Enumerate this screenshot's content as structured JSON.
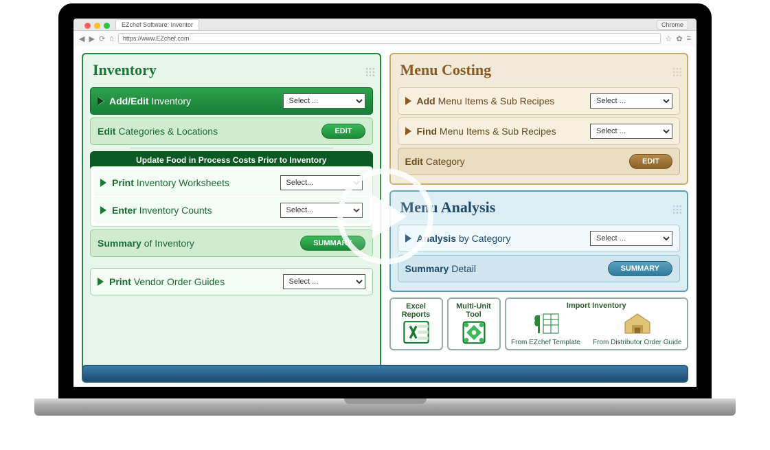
{
  "browser": {
    "tab_title": "EZchef Software: Inventor",
    "browser_name": "Chrome",
    "url": "https://www.EZchef.com"
  },
  "inventory": {
    "title": "Inventory",
    "add_edit_label": "<b>Add/Edit</b> Inventory",
    "add_edit_select": "Select ...",
    "edit_cat_label": "<b>Edit</b> Categories & Locations",
    "edit_btn": "EDIT",
    "banner": "Update Food in Process Costs Prior to Inventory",
    "print_ws_label": "<b>Print</b> Inventory Worksheets",
    "print_ws_select": "Select...",
    "enter_counts_label": "<b>Enter</b> Inventory Counts",
    "enter_counts_select": "Select...",
    "summary_label": "<b>Summary</b> of Inventory",
    "summary_btn": "SUMMARY",
    "print_vendor_label": "<b>Print</b> Vendor Order Guides",
    "print_vendor_select": "Select ..."
  },
  "menu_costing": {
    "title": "Menu Costing",
    "add_label": "<b>Add</b> Menu Items & Sub Recipes",
    "add_select": "Select ...",
    "find_label": "<b>Find</b> Menu Items & Sub Recipes",
    "find_select": "Select ...",
    "edit_cat_label": "<b>Edit</b> Category",
    "edit_btn": "EDIT"
  },
  "menu_analysis": {
    "title": "Menu Analysis",
    "analysis_label": "<b>Analysis</b>  by Category",
    "analysis_select": "Select ...",
    "summary_label": "<b>Summary</b> Detail",
    "summary_btn": "SUMMARY"
  },
  "tools": {
    "excel": "Excel Reports",
    "multi": "Multi-Unit Tool",
    "import_title": "Import Inventory",
    "import_a": "From EZchef Template",
    "import_b": "From Distributor Order Guide"
  }
}
